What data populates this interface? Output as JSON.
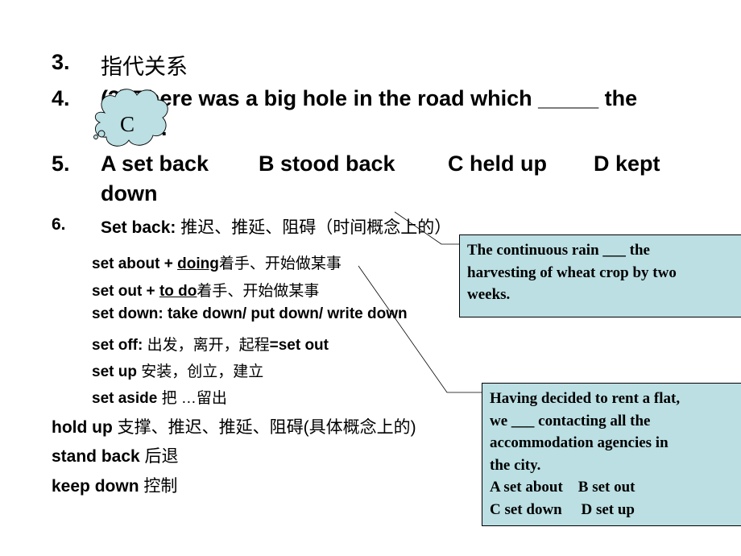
{
  "slide": {
    "items": [
      {
        "number": "3.",
        "text": "指代关系"
      },
      {
        "number": "4.",
        "text_line1": "(3) There was a big hole in the road which _____ the",
        "text_line2": "traffic."
      },
      {
        "number": "5.",
        "options_line1": [
          "A set back",
          "B stood back",
          "C held up",
          "D kept"
        ],
        "options_line2": "down"
      },
      {
        "number": "6.",
        "term": "Set back:",
        "meaning": "推迟、推延、阻碍（时间概念上的）"
      }
    ],
    "phrases": [
      {
        "term": "set about + ",
        "underlined": "doing",
        "meaning": "着手、开始做某事"
      },
      {
        "term": "set out + ",
        "underlined": "to do",
        "meaning": "着手、开始做某事"
      },
      {
        "term": "set down: take down/ put down/ write down",
        "meaning": ""
      },
      {
        "term": "set off:",
        "meaning": " 出发，离开，起程",
        "suffix": "=set out"
      },
      {
        "term": "set up",
        "meaning": " 安装，创立，建立"
      },
      {
        "term": "set aside",
        "meaning": " 把 …留出"
      }
    ],
    "more_phrases": [
      {
        "term": "hold up",
        "meaning": " 支撑、推迟、推延、阻碍(具体概念上的)"
      },
      {
        "term": "stand back",
        "meaning": " 后退"
      },
      {
        "term": "keep down",
        "meaning": " 控制"
      }
    ],
    "answer_cloud": {
      "label": "C"
    },
    "callouts": [
      {
        "lines": [
          "The continuous rain ___ the",
          "harvesting of wheat crop by two",
          "weeks."
        ]
      },
      {
        "lines": [
          "Having decided to rent a flat,",
          "we ___ contacting all  the",
          "accommodation agencies in",
          "the city.",
          "A set about    B set out",
          "C set down     D set up"
        ]
      }
    ],
    "colors": {
      "callout_fill": "#bbdfe3",
      "cloud_fill": "#bbdfe3",
      "text": "#000000"
    }
  }
}
